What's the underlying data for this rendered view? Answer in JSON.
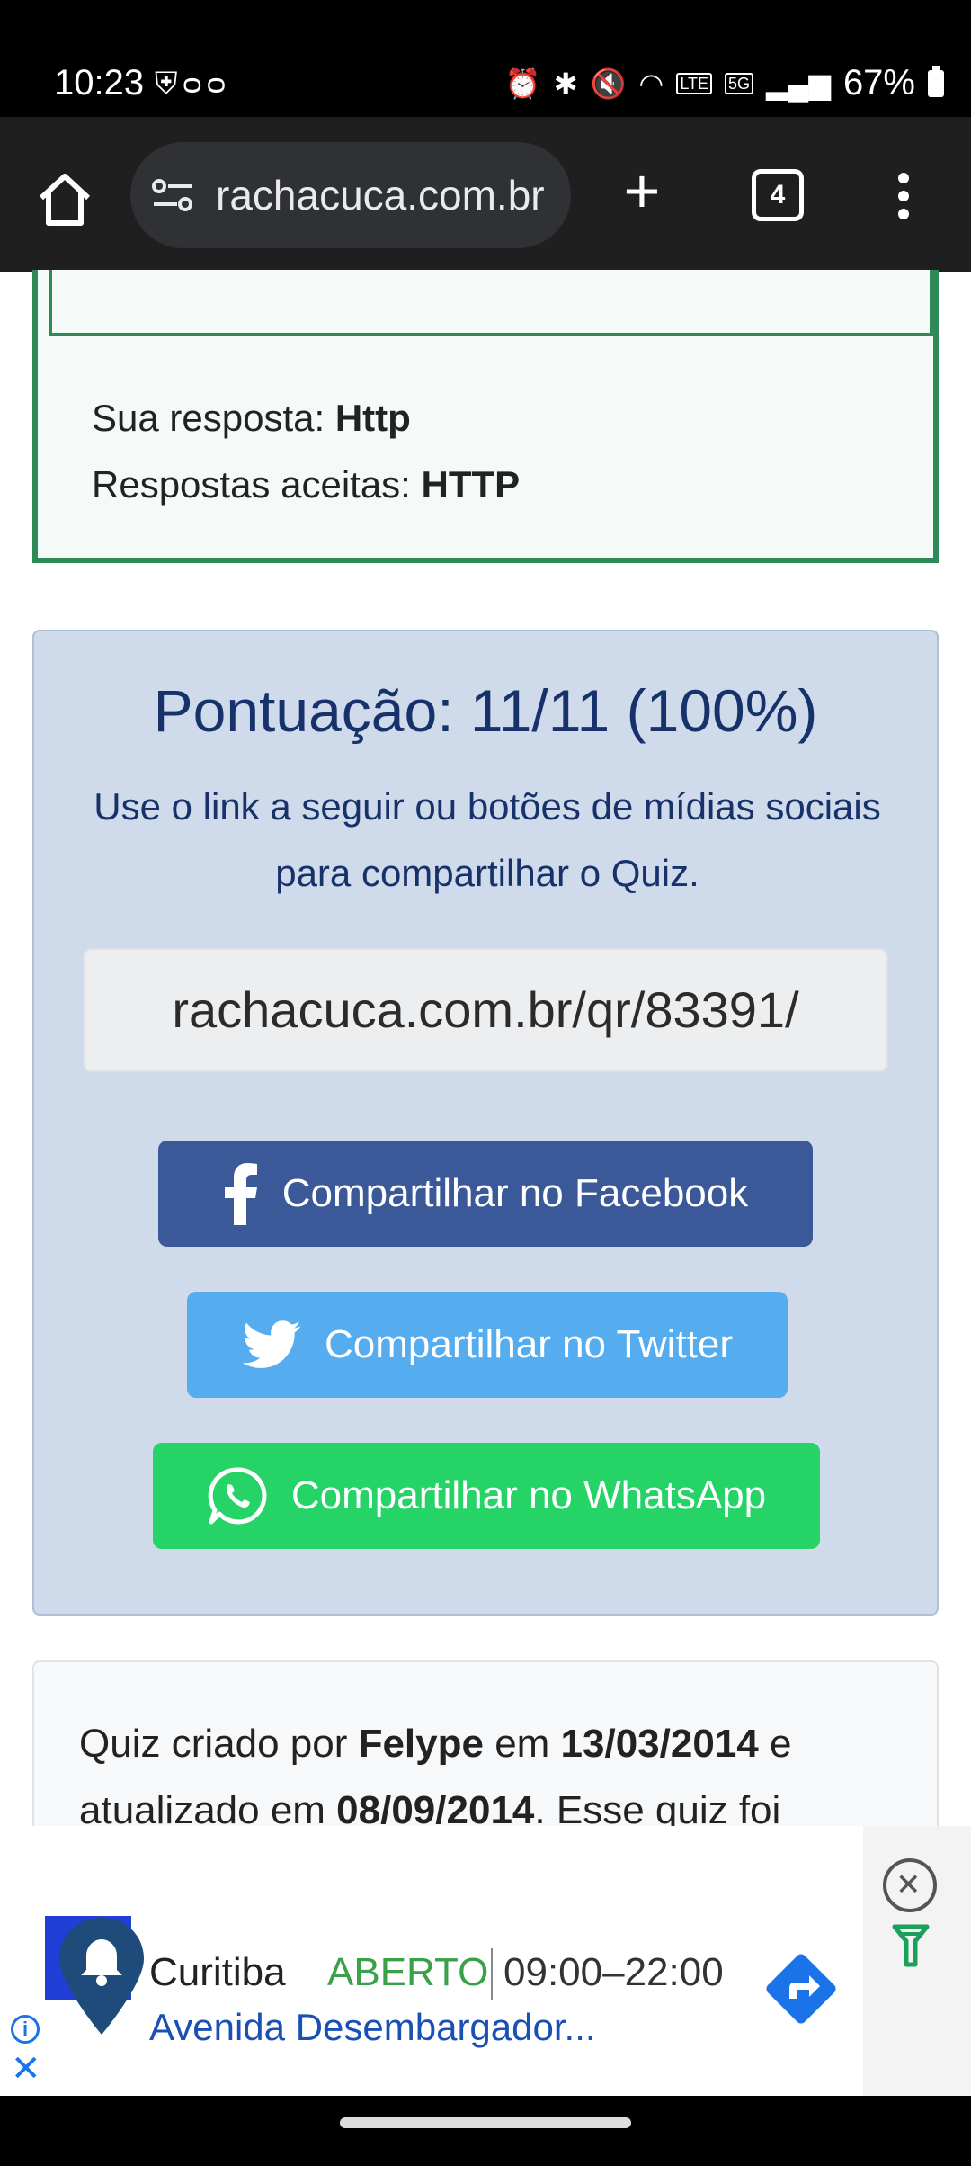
{
  "status_bar": {
    "time": "10:23",
    "battery": "67%",
    "network": "5G"
  },
  "browser": {
    "url": "rachacuca.com.br",
    "tab_count": "4"
  },
  "answer": {
    "your_answer_label": "Sua resposta:",
    "your_answer_value": "Http",
    "accepted_label": "Respostas aceitas:",
    "accepted_value": "HTTP"
  },
  "score": {
    "title": "Pontuação: 11/11 (100%)",
    "description": "Use o link a seguir ou botões de mídias sociais para compartilhar o Quiz.",
    "share_link": "rachacuca.com.br/qr/83391/",
    "facebook_label": "Compartilhar no Facebook",
    "twitter_label": "Compartilhar no Twitter",
    "whatsapp_label": "Compartilhar no WhatsApp"
  },
  "info": {
    "prefix": "Quiz criado por ",
    "author": "Felype",
    "mid1": " em ",
    "created": "13/03/2014",
    "mid2": " e atualizado em ",
    "updated": "08/09/2014",
    "suffix": ". Esse quiz foi"
  },
  "ad": {
    "city": "Curitiba",
    "status": "ABERTO",
    "hours": "09:00–22:00",
    "address": "Avenida Desembargador..."
  },
  "colors": {
    "facebook": "#3b5998",
    "twitter": "#55acee",
    "whatsapp": "#25d366",
    "answer_border": "#2e8b57",
    "score_bg": "#cfdaea",
    "score_text": "#17326a"
  }
}
